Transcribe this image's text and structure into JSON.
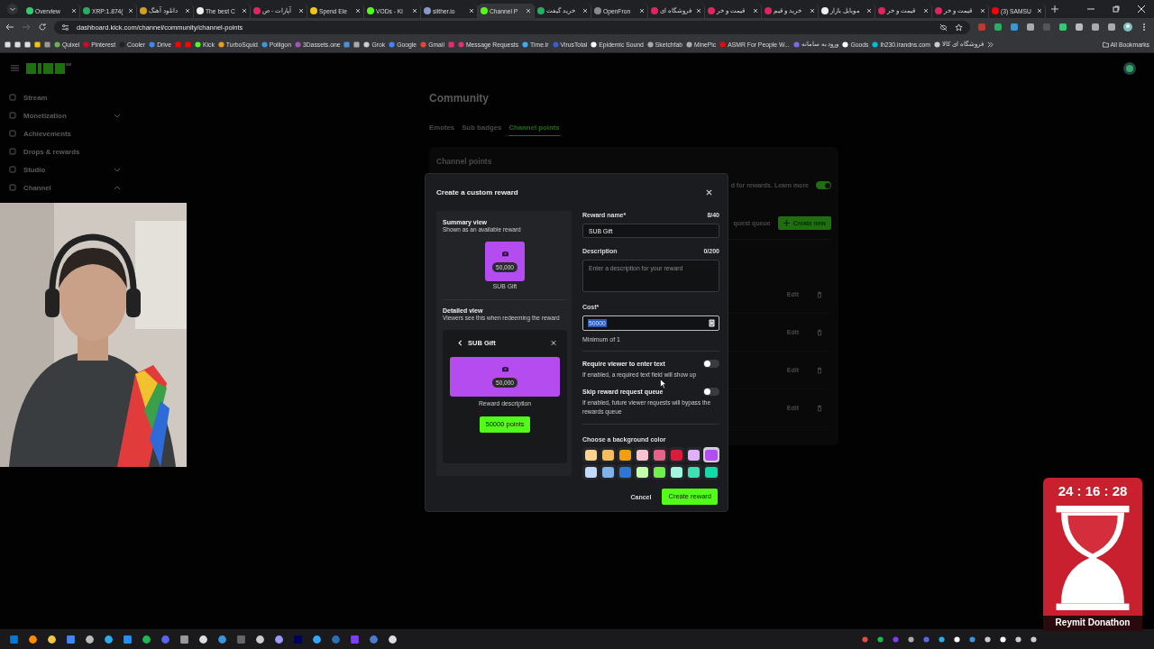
{
  "browser": {
    "tabs": [
      {
        "title": "Overview",
        "selected": false
      },
      {
        "title": "XRP:1.874(",
        "selected": false
      },
      {
        "title": "دانلود آهنگ",
        "selected": false
      },
      {
        "title": "The best C",
        "selected": false
      },
      {
        "title": "آپارات - ص",
        "selected": false
      },
      {
        "title": "Spend Ele",
        "selected": false
      },
      {
        "title": "VODs - Ki",
        "selected": false
      },
      {
        "title": "slither.io",
        "selected": false
      },
      {
        "title": "Channel P",
        "selected": true
      },
      {
        "title": "خرید گیفت",
        "selected": false
      },
      {
        "title": "OpenFron",
        "selected": false
      },
      {
        "title": "فروشگاه ای",
        "selected": false
      },
      {
        "title": "قیمت و خر",
        "selected": false
      },
      {
        "title": "خرید و قیم",
        "selected": false
      },
      {
        "title": "موبایل بازار",
        "selected": false
      },
      {
        "title": "قیمت و خر",
        "selected": false
      },
      {
        "title": "قیمت و خر",
        "selected": false
      },
      {
        "title": "(3) SAMSU",
        "selected": false
      }
    ],
    "url": "dashboard.kick.com/channel/community/channel-points",
    "bookmarks": [
      {
        "kind": "icon"
      },
      {
        "kind": "icon"
      },
      {
        "kind": "icon"
      },
      {
        "kind": "icon"
      },
      {
        "kind": "icon"
      },
      {
        "kind": "link",
        "label": "Quixel"
      },
      {
        "kind": "link",
        "label": "Pinterest"
      },
      {
        "kind": "link",
        "label": "Cooler"
      },
      {
        "kind": "link",
        "label": "Drive"
      },
      {
        "kind": "icon"
      },
      {
        "kind": "icon"
      },
      {
        "kind": "link",
        "label": "Kick"
      },
      {
        "kind": "link",
        "label": "TurboSquid"
      },
      {
        "kind": "link",
        "label": "Poliigon"
      },
      {
        "kind": "link",
        "label": "3Dassets.one"
      },
      {
        "kind": "icon"
      },
      {
        "kind": "icon"
      },
      {
        "kind": "link",
        "label": "Grok"
      },
      {
        "kind": "link",
        "label": "Google"
      },
      {
        "kind": "link",
        "label": "Gmail"
      },
      {
        "kind": "icon"
      },
      {
        "kind": "link",
        "label": "Message Requests"
      },
      {
        "kind": "link",
        "label": "Time.lr"
      },
      {
        "kind": "link",
        "label": "VirusTotal"
      },
      {
        "kind": "link",
        "label": "Epidemic Sound"
      },
      {
        "kind": "link",
        "label": "Sketchfab"
      },
      {
        "kind": "link",
        "label": "MinePic"
      },
      {
        "kind": "link",
        "label": "ASMR For People W..."
      },
      {
        "kind": "link",
        "label": "ورود به سامانه"
      },
      {
        "kind": "link",
        "label": "Goods"
      },
      {
        "kind": "link",
        "label": "lh230.irandns.com"
      },
      {
        "kind": "link",
        "label": "فروشگاه ای کالا"
      }
    ],
    "all_bookmarks": "All Bookmarks"
  },
  "sidebar": {
    "items": [
      {
        "label": "Stream",
        "kind": "link"
      },
      {
        "label": "Monetization",
        "kind": "group",
        "expanded": false
      },
      {
        "label": "Achievements",
        "kind": "link"
      },
      {
        "label": "Drops & rewards",
        "kind": "link"
      },
      {
        "label": "Studio",
        "kind": "group",
        "expanded": false
      },
      {
        "label": "Channel",
        "kind": "group",
        "expanded": true
      }
    ]
  },
  "page": {
    "title": "Community",
    "tabs": [
      {
        "label": "Emotes",
        "selected": false
      },
      {
        "label": "Sub badges",
        "selected": false
      },
      {
        "label": "Channel points",
        "selected": true
      }
    ],
    "section_title": "Channel points",
    "notice": "d for rewards. Learn more",
    "points_enabled": true,
    "queue_label": "quest queue",
    "create_label": "Create new",
    "rows": [
      {
        "action": "Edit"
      },
      {
        "action": "Edit"
      },
      {
        "action": "Edit"
      },
      {
        "action": "Edit"
      }
    ]
  },
  "modal": {
    "title": "Create a custom reward",
    "summary": {
      "heading": "Summary view",
      "subtitle": "Shown as an available reward",
      "cost": "50,000",
      "name": "SUB Gift"
    },
    "detailed": {
      "heading": "Detailed view",
      "subtitle": "Viewers see this when redeeming the reward",
      "title": "SUB Gift",
      "cost": "50,000",
      "description": "Reward description",
      "button": "50000 points"
    },
    "name_field": {
      "label": "Reward name*",
      "counter": "8/40",
      "value": "SUB Gift"
    },
    "description_field": {
      "label": "Description",
      "counter": "0/200",
      "placeholder": "Enter a description for your reward"
    },
    "cost_field": {
      "label": "Cost*",
      "value": "50000",
      "text_selected": true,
      "hint": "Minimum of 1"
    },
    "toggles": [
      {
        "label": "Require viewer to enter text",
        "description": "If enabled, a required text field will show up",
        "on": false
      },
      {
        "label": "Skip reward request queue",
        "description": "If enabled, future viewer requests will bypass the rewards queue",
        "on": false
      }
    ],
    "color_label": "Choose a background color",
    "swatches": [
      {
        "color": "#fbd38d",
        "selected": false
      },
      {
        "color": "#f6bd60",
        "selected": false
      },
      {
        "color": "#f59e0b",
        "selected": false
      },
      {
        "color": "#f9c4d2",
        "selected": false
      },
      {
        "color": "#e8638a",
        "selected": false
      },
      {
        "color": "#dc1a3c",
        "selected": false
      },
      {
        "color": "#e0b0ff",
        "selected": false
      },
      {
        "color": "#b44cf0",
        "selected": true
      },
      {
        "color": "#c3dafe",
        "selected": false
      },
      {
        "color": "#7fb3ea",
        "selected": false
      },
      {
        "color": "#2f74d9",
        "selected": false
      },
      {
        "color": "#c6ffb0",
        "selected": false
      },
      {
        "color": "#6ff04a",
        "selected": false
      },
      {
        "color": "#a3f5e0",
        "selected": false
      },
      {
        "color": "#3ee0b3",
        "selected": false
      },
      {
        "color": "#14d9a8",
        "selected": false
      }
    ],
    "cancel": "Cancel",
    "submit": "Create reward"
  },
  "timer": {
    "time": "24 : 16 : 28",
    "label": "Reymit Donathon"
  }
}
